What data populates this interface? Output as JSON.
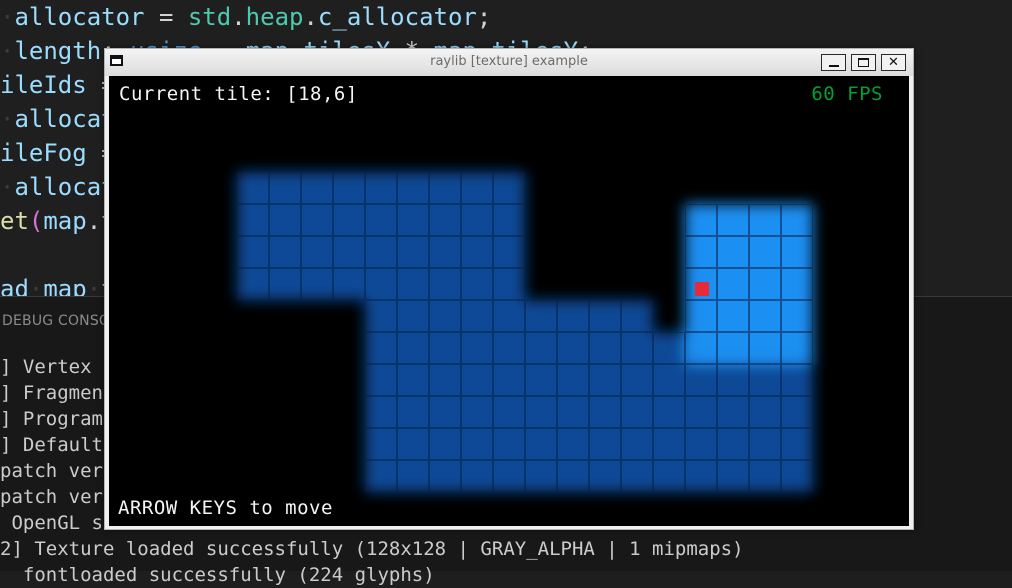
{
  "editor": {
    "code_lines": [
      [
        {
          "c": "ws",
          "t": "·"
        },
        {
          "c": "vr",
          "t": "allocator"
        },
        {
          "c": "op",
          "t": " = "
        },
        {
          "c": "ty",
          "t": "std"
        },
        {
          "c": "pn",
          "t": "."
        },
        {
          "c": "ty",
          "t": "heap"
        },
        {
          "c": "pn",
          "t": "."
        },
        {
          "c": "vr",
          "t": "c_allocator"
        },
        {
          "c": "pn",
          "t": ";"
        }
      ],
      [
        {
          "c": "ws",
          "t": "·"
        },
        {
          "c": "vr",
          "t": "length"
        },
        {
          "c": "pn",
          "t": ": "
        },
        {
          "c": "kw",
          "t": "usize"
        },
        {
          "c": "op",
          "t": " = "
        },
        {
          "c": "vr",
          "t": "map"
        },
        {
          "c": "pn",
          "t": "."
        },
        {
          "c": "vr",
          "t": "tilesX"
        },
        {
          "c": "op",
          "t": " * "
        },
        {
          "c": "vr",
          "t": "map"
        },
        {
          "c": "pn",
          "t": "."
        },
        {
          "c": "vr",
          "t": "tilesY"
        },
        {
          "c": "pn",
          "t": ";"
        }
      ],
      [
        {
          "c": "vr",
          "t": "ileIds"
        },
        {
          "c": "op",
          "t": " ="
        }
      ],
      [
        {
          "c": "ws",
          "t": "·"
        },
        {
          "c": "vr",
          "t": "allocat"
        }
      ],
      [
        {
          "c": "vr",
          "t": "ileFog"
        },
        {
          "c": "op",
          "t": " ="
        }
      ],
      [
        {
          "c": "ws",
          "t": "·"
        },
        {
          "c": "vr",
          "t": "allocat"
        }
      ],
      [
        {
          "c": "fn",
          "t": "et"
        },
        {
          "c": "pr",
          "t": "("
        },
        {
          "c": "vr",
          "t": "map"
        },
        {
          "c": "pn",
          "t": "."
        },
        {
          "c": "vr",
          "t": "t"
        }
      ],
      [],
      [
        {
          "c": "vr",
          "t": "ad"
        },
        {
          "c": "ws",
          "t": "·"
        },
        {
          "c": "vr",
          "t": "map"
        },
        {
          "c": "ws",
          "t": "·"
        },
        {
          "c": "vr",
          "t": "t"
        }
      ]
    ],
    "panel_tab": "DEBUG CONSOLE",
    "console_lines": [
      "] Vertex s",
      "] Fragment",
      "] Program",
      "] Default",
      "patch vert",
      "patch vert",
      " OpenGL st",
      "2] Texture loaded successfully (128x128 | GRAY_ALPHA | 1 mipmaps)",
      "  fontloaded successfully (224 glyphs)"
    ]
  },
  "window": {
    "title": "raylib [texture] example",
    "icons": {
      "app": "window-icon",
      "minimize": "minimize-icon",
      "maximize": "maximize-icon",
      "close": "close-icon"
    },
    "close_glyph": "✕"
  },
  "game": {
    "current_tile_text": "Current tile: [18,6]",
    "fps_text": "60 FPS",
    "help_text": "ARROW KEYS to move",
    "colors": {
      "background": "#000000",
      "fog_dim": "#0b4896",
      "visible": "#1f8ff2",
      "player": "#e62a3a",
      "grid_line": "#06224a",
      "fps": "#00a033"
    },
    "map": {
      "cols": 25,
      "rows": 14,
      "rows_data": [
        ".........................",
        ".........................",
        ".........................",
        "....DDDDDDDDD............",
        "....DDDDDDDDD.....LLLL...",
        "....DDDDDDDDD.....LLLL...",
        "....DDDDDDDDD.....LLLL...",
        "........DDDDDDDDD.LLLL...",
        "........DDDDDDDDDDLLLL...",
        "........DDDDDDDDDDDDDD...",
        "........DDDDDDDDDDDDDD...",
        "........DDDDDDDDDDDDDD...",
        "........DDDDDDDDDDDDDD...",
        "........................."
      ],
      "player_tile": [
        18,
        6
      ]
    }
  }
}
